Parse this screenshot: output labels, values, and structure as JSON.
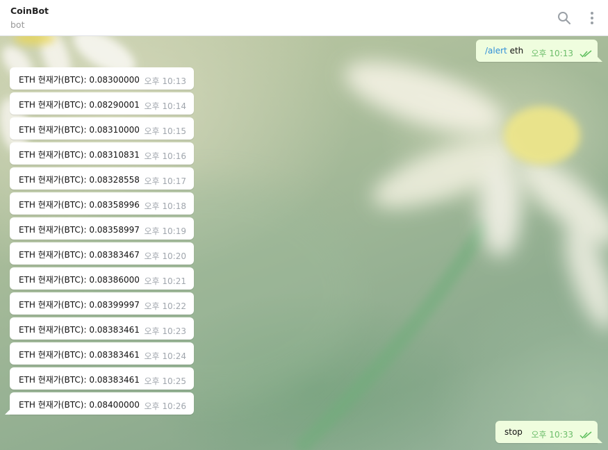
{
  "header": {
    "title": "CoinBot",
    "subtitle": "bot",
    "search_icon": "search-icon",
    "menu_icon": "more-vertical-icon"
  },
  "colors": {
    "header_bg": "#ffffff",
    "incoming_bubble": "#ffffff",
    "outgoing_bubble": "#effdde",
    "outgoing_time": "#6cbd6a",
    "incoming_time": "#a0a6ad",
    "command_link": "#2f8fd8"
  },
  "outgoing_first": {
    "command": "/alert",
    "text": " eth",
    "time": "오후 10:13",
    "status_icon": "double-check-icon"
  },
  "messages": [
    {
      "text": "ETH 현재가(BTC): 0.08300000",
      "time": "오후 10:13"
    },
    {
      "text": "ETH 현재가(BTC): 0.08290001",
      "time": "오후 10:14"
    },
    {
      "text": "ETH 현재가(BTC): 0.08310000",
      "time": "오후 10:15"
    },
    {
      "text": "ETH 현재가(BTC): 0.08310831",
      "time": "오후 10:16"
    },
    {
      "text": "ETH 현재가(BTC): 0.08328558",
      "time": "오후 10:17"
    },
    {
      "text": "ETH 현재가(BTC): 0.08358996",
      "time": "오후 10:18"
    },
    {
      "text": "ETH 현재가(BTC): 0.08358997",
      "time": "오후 10:19"
    },
    {
      "text": "ETH 현재가(BTC): 0.08383467",
      "time": "오후 10:20"
    },
    {
      "text": "ETH 현재가(BTC): 0.08386000",
      "time": "오후 10:21"
    },
    {
      "text": "ETH 현재가(BTC): 0.08399997",
      "time": "오후 10:22"
    },
    {
      "text": "ETH 현재가(BTC): 0.08383461",
      "time": "오후 10:23"
    },
    {
      "text": "ETH 현재가(BTC): 0.08383461",
      "time": "오후 10:24"
    },
    {
      "text": "ETH 현재가(BTC): 0.08383461",
      "time": "오후 10:25"
    },
    {
      "text": "ETH 현재가(BTC): 0.08400000",
      "time": "오후 10:26"
    }
  ],
  "outgoing_last": {
    "text": "stop",
    "time": "오후 10:33",
    "status_icon": "double-check-icon"
  }
}
